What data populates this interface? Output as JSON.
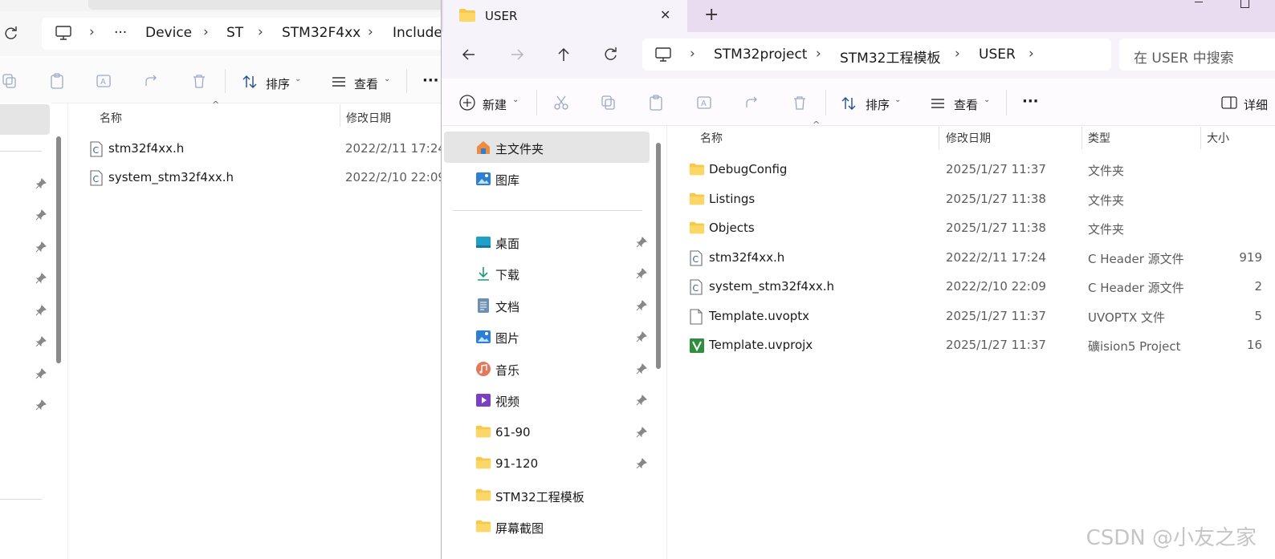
{
  "back_window": {
    "breadcrumb": [
      "···",
      "Device",
      "ST",
      "STM32F4xx",
      "Include"
    ],
    "toolbar": {
      "sort_label": "排序",
      "view_label": "查看",
      "more_label": "···"
    },
    "columns": {
      "name": "名称",
      "modified": "修改日期"
    },
    "files": [
      {
        "name": "stm32f4xx.h",
        "modified": "2022/2/11 17:24",
        "icon": "c-header-file-icon"
      },
      {
        "name": "system_stm32f4xx.h",
        "modified": "2022/2/10 22:09",
        "icon": "c-header-file-icon"
      }
    ]
  },
  "front_window": {
    "tab_title": "USER",
    "new_tab": "+",
    "close": "✕",
    "breadcrumb": [
      "STM32project",
      "STM32工程模板",
      "USER"
    ],
    "search_placeholder": "在 USER 中搜索",
    "toolbar": {
      "new_label": "新建",
      "sort_label": "排序",
      "view_label": "查看",
      "more_label": "···",
      "details_label": "详细"
    },
    "nav": {
      "home": "主文件夹",
      "gallery": "图库",
      "pinned": [
        {
          "label": "桌面",
          "icon": "desktop-icon",
          "pinned": true
        },
        {
          "label": "下载",
          "icon": "download-icon",
          "pinned": true
        },
        {
          "label": "文档",
          "icon": "documents-icon",
          "pinned": true
        },
        {
          "label": "图片",
          "icon": "pictures-icon",
          "pinned": true
        },
        {
          "label": "音乐",
          "icon": "music-icon",
          "pinned": true
        },
        {
          "label": "视频",
          "icon": "videos-icon",
          "pinned": true
        },
        {
          "label": "61-90",
          "icon": "folder-icon",
          "pinned": true
        },
        {
          "label": "91-120",
          "icon": "folder-icon",
          "pinned": true
        },
        {
          "label": "STM32工程模板",
          "icon": "folder-icon",
          "pinned": false
        },
        {
          "label": "屏幕截图",
          "icon": "folder-icon",
          "pinned": false
        }
      ]
    },
    "columns": {
      "name": "名称",
      "modified": "修改日期",
      "type": "类型",
      "size": "大小"
    },
    "files": [
      {
        "name": "DebugConfig",
        "modified": "2025/1/27 11:37",
        "type": "文件夹",
        "size": "",
        "icon": "folder-icon"
      },
      {
        "name": "Listings",
        "modified": "2025/1/27 11:38",
        "type": "文件夹",
        "size": "",
        "icon": "folder-icon"
      },
      {
        "name": "Objects",
        "modified": "2025/1/27 11:38",
        "type": "文件夹",
        "size": "",
        "icon": "folder-icon"
      },
      {
        "name": "stm32f4xx.h",
        "modified": "2022/2/11 17:24",
        "type": "C Header 源文件",
        "size": "919",
        "icon": "c-header-file-icon"
      },
      {
        "name": "system_stm32f4xx.h",
        "modified": "2022/2/10 22:09",
        "type": "C Header 源文件",
        "size": "2",
        "icon": "c-header-file-icon"
      },
      {
        "name": "Template.uvoptx",
        "modified": "2025/1/27 11:37",
        "type": "UVOPTX 文件",
        "size": "5",
        "icon": "blank-file-icon"
      },
      {
        "name": "Template.uvprojx",
        "modified": "2025/1/27 11:37",
        "type": "礦ision5 Project",
        "size": "16",
        "icon": "keil-project-icon"
      }
    ]
  },
  "watermark": "CSDN @小友之家",
  "colors": {
    "titlebar": "#e9dcf0",
    "selection": "#e5e5e5",
    "folder": "#f8c84a",
    "accent": "#1f6fbf"
  }
}
